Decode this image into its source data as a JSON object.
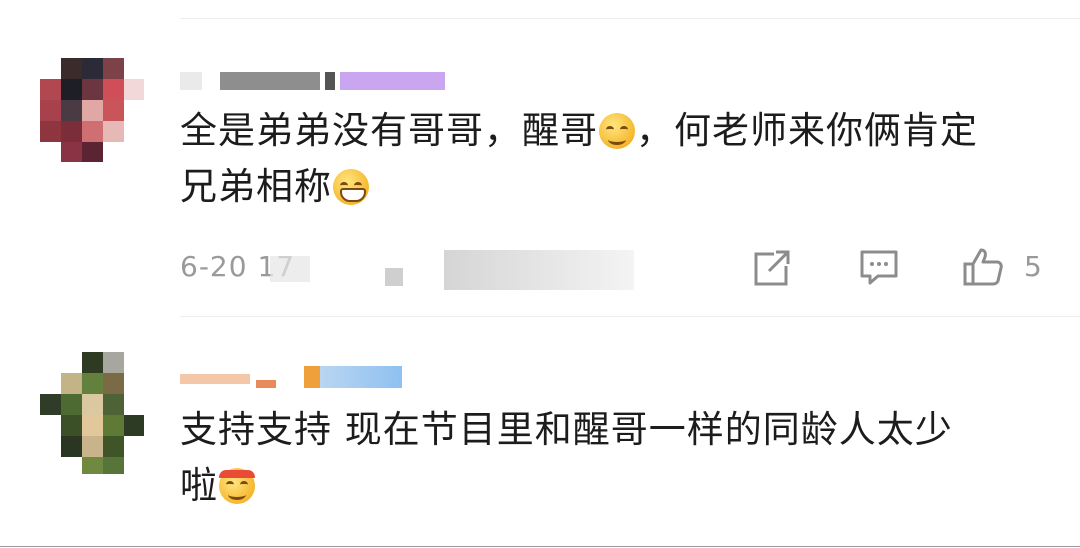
{
  "comments": [
    {
      "text_before": "全是弟弟没有哥哥，醒哥",
      "text_middle": "，何老师来你俩肯定",
      "text_line2": "兄弟相称",
      "timestamp": "6-20 17",
      "likes": "5",
      "emoji_1": "smile-emoji",
      "emoji_2": "grin-emoji"
    },
    {
      "text_line1": "支持支持 现在节目里和醒哥一样的同龄人太少",
      "text_line2": "啦",
      "emoji_1": "bandana-emoji"
    }
  ],
  "icons": {
    "share": "share-icon",
    "reply": "comment-icon",
    "like": "thumbs-up-icon"
  },
  "colors": {
    "text": "#1c1c1c",
    "meta": "#9a9a9a",
    "icon": "#8c8c8c",
    "divider": "#ececec"
  }
}
